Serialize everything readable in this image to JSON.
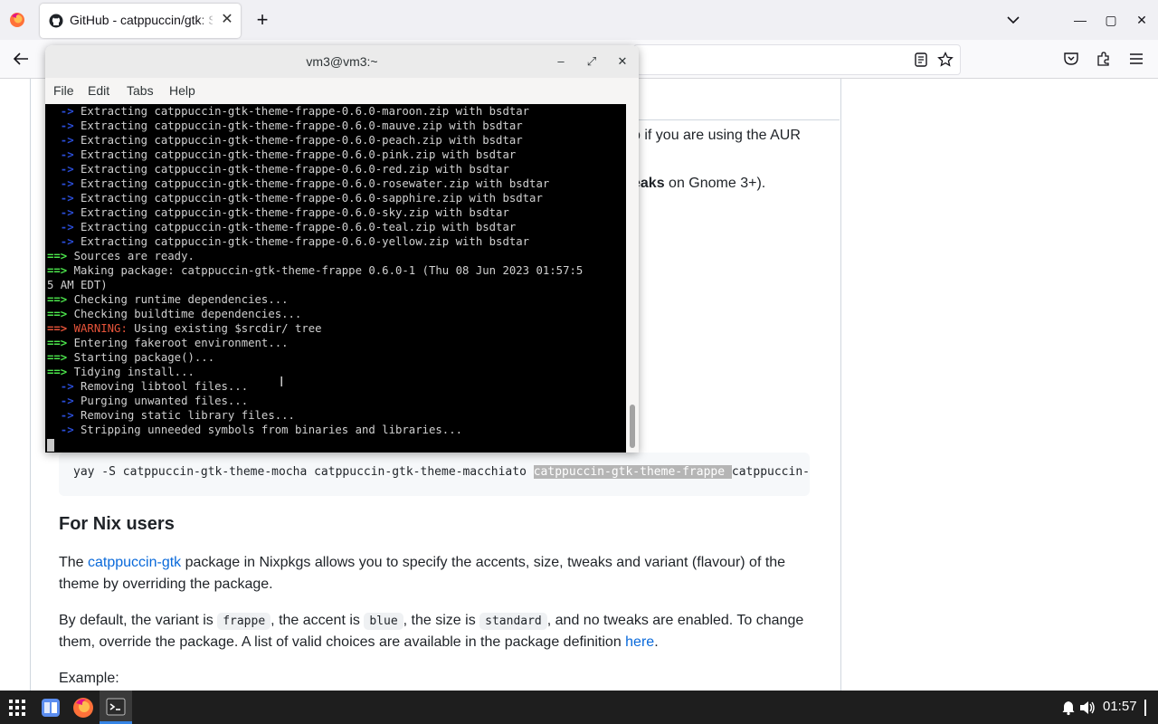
{
  "browser": {
    "tab_title": "GitHub - catppuccin/gtk: Soothing pastel theme for GTK",
    "tab_close": "✕",
    "new_tab": "+",
    "win_min": "—",
    "win_max": "▢",
    "win_close": "✕"
  },
  "page": {
    "aur_text": "p if you are using the AUR",
    "tweaks_bold": "eaks",
    "tweaks_rest": " on Gnome 3+).",
    "code": {
      "before": "yay -S catppuccin-gtk-theme-mocha catppuccin-gtk-theme-macchiato ",
      "highlight": "catppuccin-gtk-theme-frappe ",
      "after": "catppuccin-gtk-theme-latte"
    },
    "nix_heading": "For Nix users",
    "nix_p1_a": "The ",
    "nix_p1_link": "catppuccin-gtk",
    "nix_p1_b": " package in Nixpkgs allows you to specify the accents, size, tweaks and variant (flavour) of the",
    "nix_p1_line2": "theme by overriding the package.",
    "nix_p2_a": "By default, the variant is ",
    "nix_p2_code1": "frappe",
    "nix_p2_b": ", the accent is ",
    "nix_p2_code2": "blue",
    "nix_p2_c": ", the size is ",
    "nix_p2_code3": "standard",
    "nix_p2_d": ", and no tweaks are enabled. To change",
    "nix_p2_line2_a": "them, override the package. A list of valid choices are available in the package definition ",
    "nix_p2_link": "here",
    "nix_p2_line2_b": ".",
    "example": "Example:"
  },
  "terminal": {
    "title": "vm3@vm3:~",
    "menu": [
      "File",
      "Edit",
      "Tabs",
      "Help"
    ],
    "lines": [
      {
        "kind": "sub",
        "text": "Extracting catppuccin-gtk-theme-frappe-0.6.0-maroon.zip with bsdtar"
      },
      {
        "kind": "sub",
        "text": "Extracting catppuccin-gtk-theme-frappe-0.6.0-mauve.zip with bsdtar"
      },
      {
        "kind": "sub",
        "text": "Extracting catppuccin-gtk-theme-frappe-0.6.0-peach.zip with bsdtar"
      },
      {
        "kind": "sub",
        "text": "Extracting catppuccin-gtk-theme-frappe-0.6.0-pink.zip with bsdtar"
      },
      {
        "kind": "sub",
        "text": "Extracting catppuccin-gtk-theme-frappe-0.6.0-red.zip with bsdtar"
      },
      {
        "kind": "sub",
        "text": "Extracting catppuccin-gtk-theme-frappe-0.6.0-rosewater.zip with bsdtar"
      },
      {
        "kind": "sub",
        "text": "Extracting catppuccin-gtk-theme-frappe-0.6.0-sapphire.zip with bsdtar"
      },
      {
        "kind": "sub",
        "text": "Extracting catppuccin-gtk-theme-frappe-0.6.0-sky.zip with bsdtar"
      },
      {
        "kind": "sub",
        "text": "Extracting catppuccin-gtk-theme-frappe-0.6.0-teal.zip with bsdtar"
      },
      {
        "kind": "sub",
        "text": "Extracting catppuccin-gtk-theme-frappe-0.6.0-yellow.zip with bsdtar"
      },
      {
        "kind": "main",
        "text": "Sources are ready."
      },
      {
        "kind": "main",
        "text": "Making package: catppuccin-gtk-theme-frappe 0.6.0-1 (Thu 08 Jun 2023 01:57:5"
      },
      {
        "kind": "plain",
        "text": "5 AM EDT)"
      },
      {
        "kind": "main",
        "text": "Checking runtime dependencies..."
      },
      {
        "kind": "main",
        "text": "Checking buildtime dependencies..."
      },
      {
        "kind": "warn",
        "label": "WARNING:",
        "text": " Using existing $srcdir/ tree"
      },
      {
        "kind": "main",
        "text": "Entering fakeroot environment..."
      },
      {
        "kind": "main",
        "text": "Starting package()..."
      },
      {
        "kind": "main",
        "text": "Tidying install..."
      },
      {
        "kind": "sub",
        "text": "Removing libtool files..."
      },
      {
        "kind": "sub",
        "text": "Purging unwanted files..."
      },
      {
        "kind": "sub",
        "text": "Removing static library files..."
      },
      {
        "kind": "sub",
        "text": "Stripping unneeded symbols from binaries and libraries..."
      }
    ],
    "arrow_main": "==>",
    "arrow_sub": "->"
  },
  "taskbar": {
    "clock": "01:57"
  },
  "colors": {
    "link": "#0969da",
    "terminal_bg": "#000000",
    "arrow_green": "#4ce64c",
    "arrow_blue": "#2a4dd8",
    "warning": "#e8543a"
  }
}
